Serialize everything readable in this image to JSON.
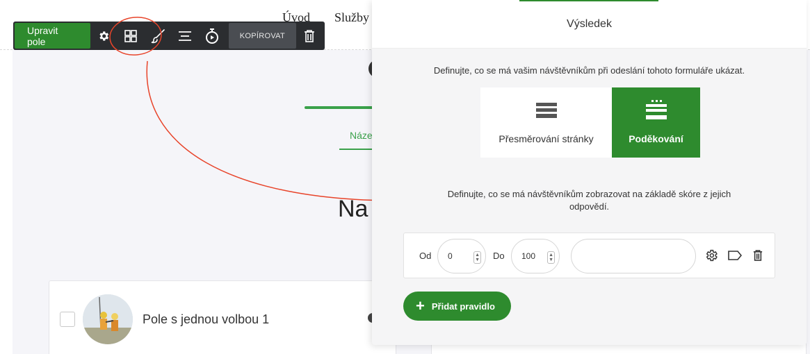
{
  "background": {
    "nav_links": [
      "Úvod",
      "Služby"
    ],
    "active_tab_partial": "Náze",
    "heading_partial": "Na",
    "field_label": "Pole s jednou volbou 1"
  },
  "toolbar": {
    "edit_fields_label": "Upravit pole",
    "copy_label": "KOPÍROVAT",
    "icons": [
      "gear-icon",
      "layout-grid-icon",
      "brush-icon",
      "align-icon",
      "timer-icon",
      "trash-icon"
    ]
  },
  "panel": {
    "title": "Výsledek",
    "description": "Definujte, co se má vašim návštěvníkům při odeslání tohoto formuláře ukázat.",
    "options": [
      {
        "label": "Přesměrování stránky",
        "selected": false
      },
      {
        "label": "Poděkování",
        "selected": true
      }
    ],
    "score_description": "Definujte, co se má návštěvníkům zobrazovat na základě skóre z jejich odpovědí.",
    "rule": {
      "from_label": "Od",
      "from_value": "0",
      "to_label": "Do",
      "to_value": "100",
      "text_value": ""
    },
    "add_rule_label": "Přidat pravidlo"
  },
  "colors": {
    "accent": "#2e8b2e",
    "toolbar_bg": "#2b2d30",
    "annotation": "#e8442a"
  }
}
